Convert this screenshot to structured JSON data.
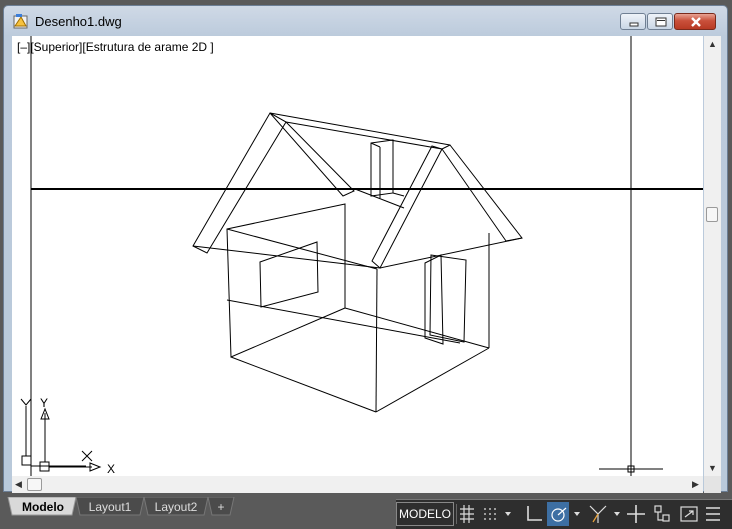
{
  "window": {
    "title": "Desenho1.dwg"
  },
  "viewport": {
    "label_prefix": "[–]",
    "label": "[Superior][Estrutura de arame 2D ]"
  },
  "ucs": {
    "x_label": "X",
    "y_label": "Y"
  },
  "tabs": [
    {
      "label": "Modelo",
      "active": true
    },
    {
      "label": "Layout1",
      "active": false
    },
    {
      "label": "Layout2",
      "active": false
    },
    {
      "label": "+",
      "active": false
    }
  ],
  "statusbar": {
    "model": "MODELO",
    "icons": [
      "grid-icon",
      "snap-icon",
      "dropdown-icon",
      "ortho-icon",
      "polar-icon",
      "dropdown-icon",
      "isodraft-icon",
      "dropdown-icon",
      "crosshair-icon",
      "ucs-icon",
      "fullscreen-icon",
      "menu-icon"
    ]
  },
  "colors": {
    "accent": "#4a90d9",
    "statusbar_bg": "#2e2e2e"
  }
}
